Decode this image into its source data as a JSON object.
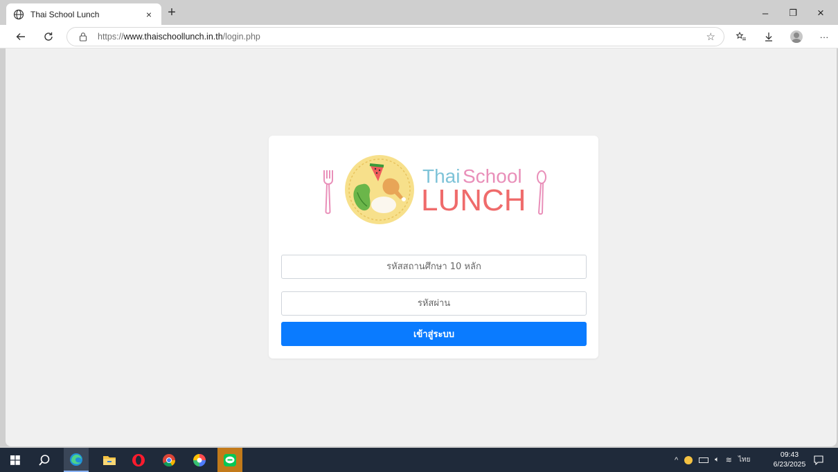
{
  "browser": {
    "tab_title": "Thai School Lunch",
    "tab_close": "×",
    "new_tab": "+",
    "url_prefix": "https://",
    "url_host": "www.thaischoollunch.in.th",
    "url_path": "/login.php",
    "window_min": "–",
    "window_restore": "❐",
    "window_close": "×"
  },
  "logo": {
    "line1_a": "Thai",
    "line1_b": "School",
    "line2": "LUNCH"
  },
  "form": {
    "school_code_placeholder": "รหัสสถานศึกษา 10 หลัก",
    "password_placeholder": "รหัสผ่าน",
    "submit_label": "เข้าสู่ระบบ"
  },
  "taskbar": {
    "language": "ไทย",
    "time": "09:43",
    "date": "6/23/2025"
  },
  "colors": {
    "primary_button": "#0a7bff",
    "logo_blue": "#7ec3d8",
    "logo_pink": "#e98fb9",
    "logo_red": "#ef6b6b",
    "taskbar": "#1f2a3a"
  }
}
